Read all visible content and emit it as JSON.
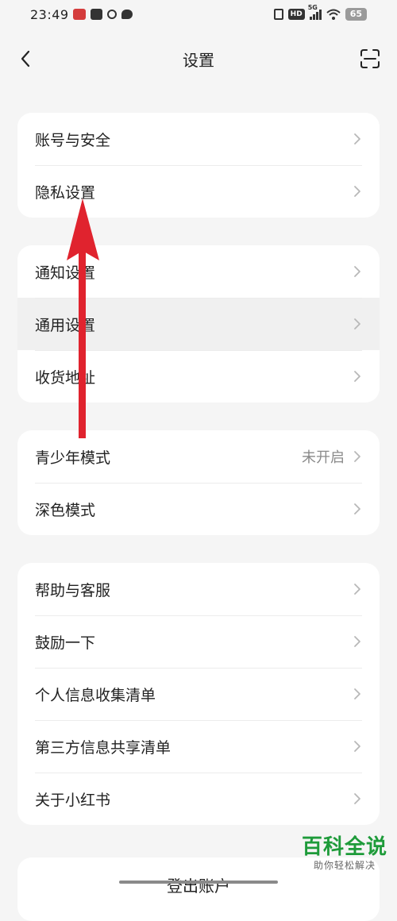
{
  "status_bar": {
    "time": "23:49",
    "network": "5G",
    "hd": "HD",
    "battery": "65"
  },
  "header": {
    "title": "设置"
  },
  "groups": [
    {
      "items": [
        {
          "label": "账号与安全",
          "value": ""
        },
        {
          "label": "隐私设置",
          "value": ""
        }
      ]
    },
    {
      "items": [
        {
          "label": "通知设置",
          "value": ""
        },
        {
          "label": "通用设置",
          "value": ""
        },
        {
          "label": "收货地址",
          "value": ""
        }
      ]
    },
    {
      "items": [
        {
          "label": "青少年模式",
          "value": "未开启"
        },
        {
          "label": "深色模式",
          "value": ""
        }
      ]
    },
    {
      "items": [
        {
          "label": "帮助与客服",
          "value": ""
        },
        {
          "label": "鼓励一下",
          "value": ""
        },
        {
          "label": "个人信息收集清单",
          "value": ""
        },
        {
          "label": "第三方信息共享清单",
          "value": ""
        },
        {
          "label": "关于小红书",
          "value": ""
        }
      ]
    }
  ],
  "logout": {
    "label": "登出账户"
  },
  "watermark": {
    "title": "百科全说",
    "subtitle": "助你轻松解决"
  },
  "colors": {
    "background": "#f5f5f5",
    "card": "#ffffff",
    "arrow": "#e0232e",
    "watermark": "#1e9b3a"
  }
}
